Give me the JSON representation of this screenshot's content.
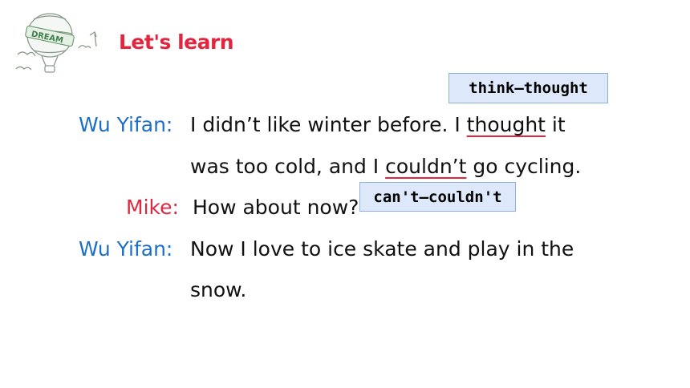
{
  "header": {
    "title": "Let's learn",
    "logo_word": "DREAM"
  },
  "colors": {
    "title": "#e3263f",
    "speaker_wu": "#1d6fc5",
    "speaker_mike": "#e3263f",
    "underline": "#e3263f",
    "box_bg": "#dde9fb"
  },
  "notes": {
    "thought": "think—thought",
    "couldnt": "can't—couldn't"
  },
  "dialogue": {
    "line1": {
      "speaker": "Wu Yifan:",
      "pre": "I didn’t like winter before. I ",
      "highlight": "thought",
      "post": " it"
    },
    "line2": {
      "pre": "was too cold, and I ",
      "highlight": "couldn’t",
      "post": " go cycling."
    },
    "line3": {
      "speaker": "Mike:",
      "text": "How about now?"
    },
    "line4": {
      "speaker": "Wu Yifan:",
      "text": "Now I love to ice skate and play in the"
    },
    "line5": {
      "text": "snow."
    }
  }
}
